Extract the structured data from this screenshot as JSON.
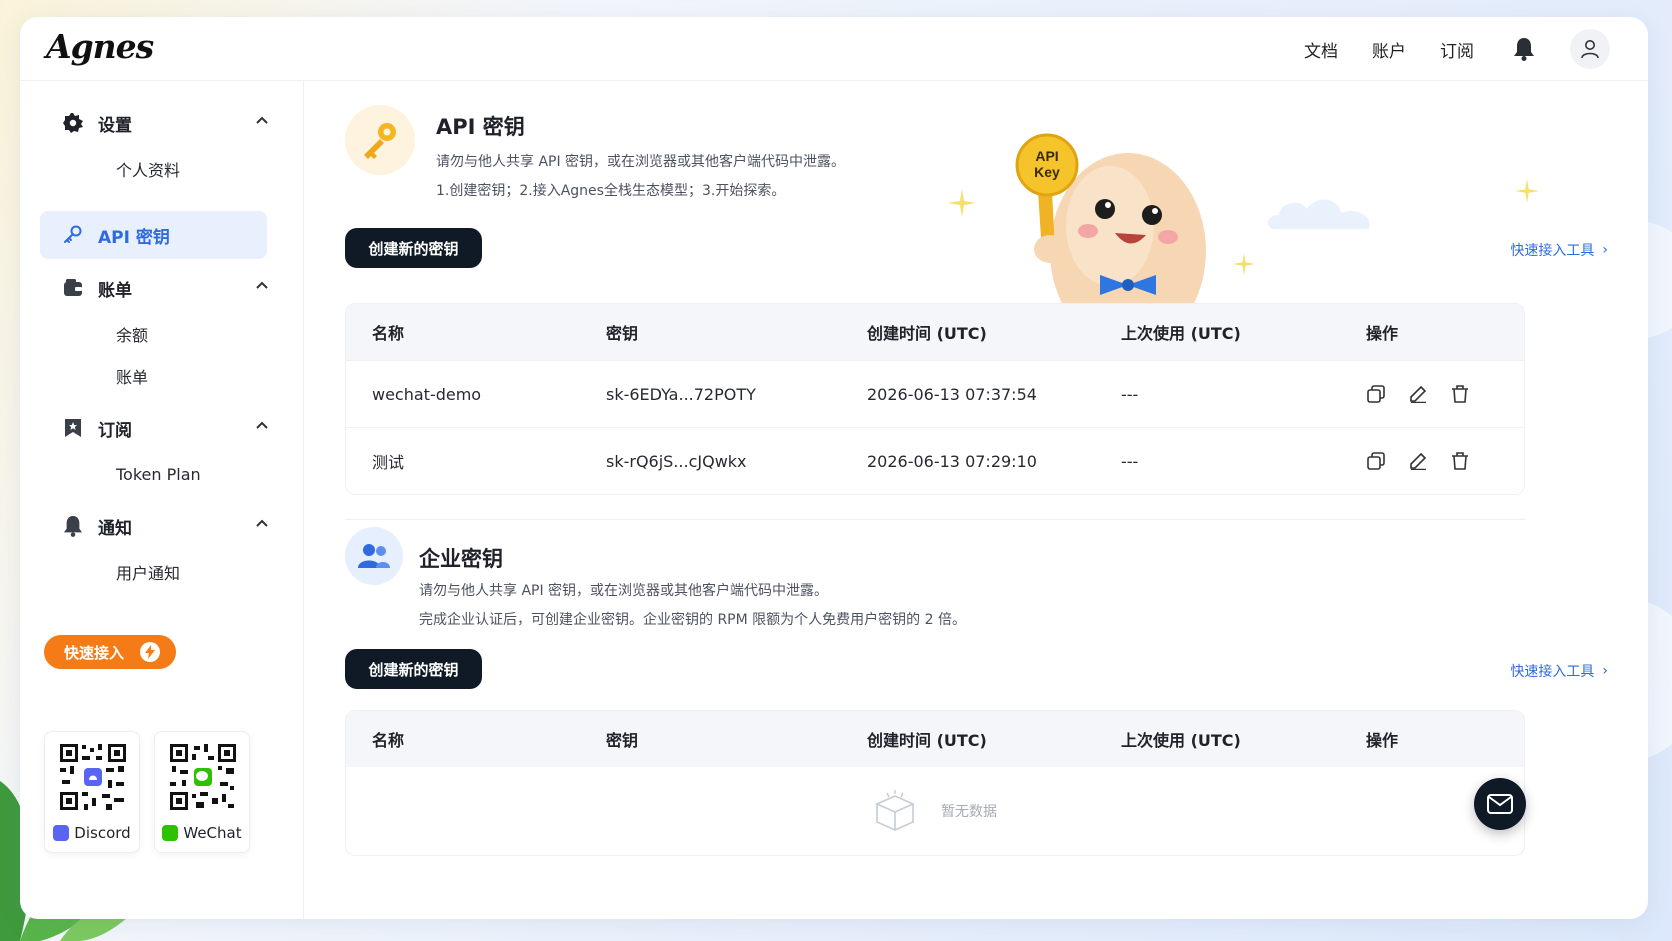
{
  "header": {
    "logo": "Agnes",
    "nav": [
      "文档",
      "账户",
      "订阅"
    ]
  },
  "sidebar": {
    "settings": {
      "label": "设置",
      "items": [
        "个人资料"
      ]
    },
    "active_item": "API 密钥",
    "billing": {
      "label": "账单",
      "items": [
        "余额",
        "账单"
      ]
    },
    "subscription": {
      "label": "订阅",
      "items": [
        "Token Plan"
      ]
    },
    "notifications": {
      "label": "通知",
      "items": [
        "用户通知"
      ]
    },
    "quick_access": "快速接入",
    "qr": [
      {
        "label": "Discord",
        "color": "#5865f2"
      },
      {
        "label": "WeChat",
        "color": "#2dc100"
      }
    ]
  },
  "api_section": {
    "title": "API 密钥",
    "desc1": "请勿与他人共享 API 密钥，或在浏览器或其他客户端代码中泄露。",
    "desc2": "1.创建密钥；2.接入Agnes全栈生态模型；3.开始探索。",
    "create_button": "创建新的密钥",
    "tool_link": "快速接入工具",
    "mascot_key_text": "API Key",
    "table": {
      "headers": [
        "名称",
        "密钥",
        "创建时间 (UTC)",
        "上次使用 (UTC)",
        "操作"
      ],
      "rows": [
        {
          "name": "wechat-demo",
          "key": "sk-6EDYa...72POTY",
          "created": "2026-06-13 07:37:54",
          "last_used": "---"
        },
        {
          "name": "测试",
          "key": "sk-rQ6jS...cJQwkx",
          "created": "2026-06-13 07:29:10",
          "last_used": "---"
        }
      ]
    }
  },
  "enterprise_section": {
    "title": "企业密钥",
    "desc1": "请勿与他人共享 API 密钥，或在浏览器或其他客户端代码中泄露。",
    "desc2": "完成企业认证后，可创建企业密钥。企业密钥的 RPM 限额为个人免费用户密钥的 2 倍。",
    "create_button": "创建新的密钥",
    "tool_link": "快速接入工具",
    "table": {
      "headers": [
        "名称",
        "密钥",
        "创建时间 (UTC)",
        "上次使用 (UTC)",
        "操作"
      ],
      "empty_text": "暂无数据"
    }
  },
  "colors": {
    "accent": "#2f6bde",
    "dark_button": "#0f1a26",
    "orange": "#f47b16"
  }
}
